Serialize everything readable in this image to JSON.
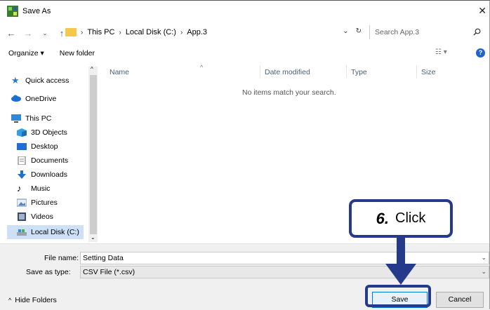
{
  "window": {
    "title": "Save As"
  },
  "address": {
    "crumbs": [
      "This PC",
      "Local Disk (C:)",
      "App.3"
    ]
  },
  "search": {
    "placeholder": "Search App.3"
  },
  "toolbar": {
    "organize": "Organize ▾",
    "new_folder": "New folder"
  },
  "sidebar": {
    "items": [
      {
        "label": "Quick access",
        "icon": "star-icon"
      },
      {
        "label": "OneDrive",
        "icon": "cloud-icon"
      },
      {
        "label": "This PC",
        "icon": "computer-icon"
      },
      {
        "label": "3D Objects",
        "icon": "cube-icon"
      },
      {
        "label": "Desktop",
        "icon": "desktop-icon"
      },
      {
        "label": "Documents",
        "icon": "document-icon"
      },
      {
        "label": "Downloads",
        "icon": "download-icon"
      },
      {
        "label": "Music",
        "icon": "music-icon"
      },
      {
        "label": "Pictures",
        "icon": "picture-icon"
      },
      {
        "label": "Videos",
        "icon": "video-icon"
      },
      {
        "label": "Local Disk (C:)",
        "icon": "drive-icon",
        "selected": true
      }
    ]
  },
  "columns": [
    "Name",
    "Date modified",
    "Type",
    "Size"
  ],
  "content": {
    "empty_message": "No items match your search."
  },
  "form": {
    "file_name_label": "File name:",
    "file_name_value": "Setting Data",
    "save_type_label": "Save as type:",
    "save_type_value": "CSV File (*.csv)"
  },
  "footer": {
    "hide_folders": "Hide Folders",
    "save_label": "Save",
    "cancel_label": "Cancel"
  },
  "callout": {
    "step": "6.",
    "text": "Click",
    "color": "#263a8c"
  }
}
